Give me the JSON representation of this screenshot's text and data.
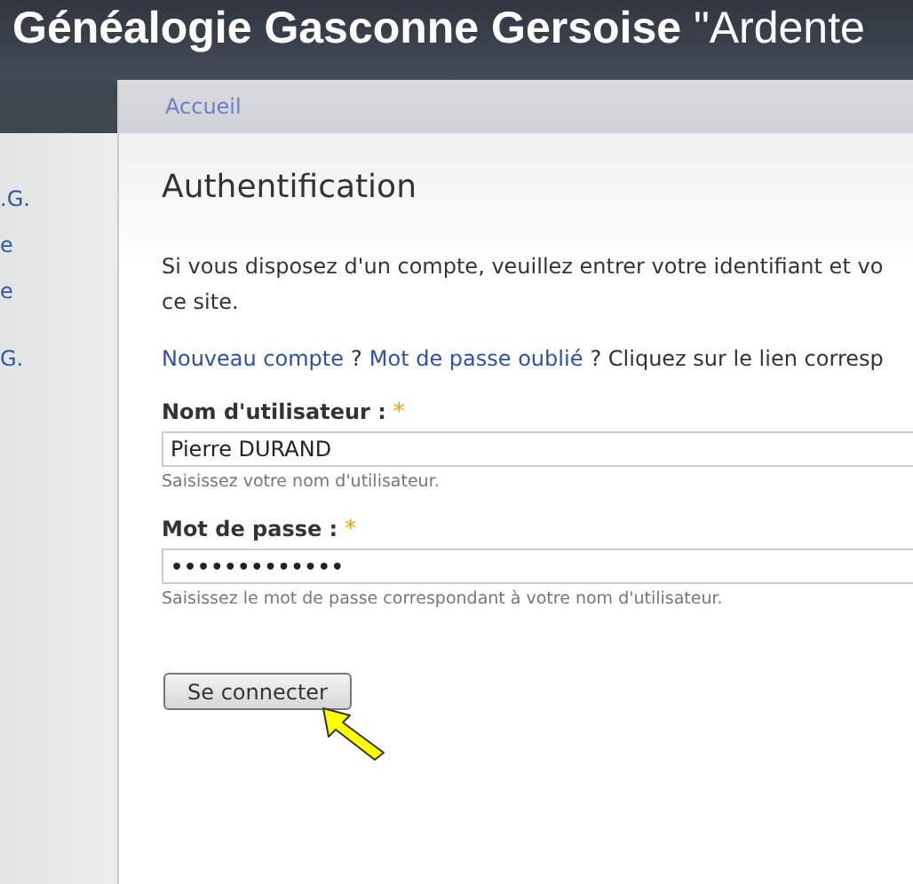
{
  "site_title": "**Généalogie Gasconne Gersoise** \"Ardente",
  "sidebar": {
    "items": [
      ".G.",
      "e",
      "e",
      "G."
    ]
  },
  "breadcrumb": "Accueil",
  "heading": "Authentification",
  "intro_lines": [
    "Si vous disposez d'un compte, veuillez entrer votre identifiant et vo",
    "ce site."
  ],
  "help_line": [
    {
      "kind": "link",
      "text": "Nouveau compte"
    },
    {
      "kind": "text",
      "text": "?"
    },
    {
      "kind": "link",
      "text": "Mot de passe oublié"
    },
    {
      "kind": "text",
      "text": "? Cliquez sur le lien corresp"
    }
  ],
  "fields": [
    {
      "label": "Nom d'utilisateur :",
      "required_mark": "*",
      "value": "Pierre DURAND",
      "masked": false,
      "hint": "Saisissez votre nom d'utilisateur."
    },
    {
      "label": "Mot de passe :",
      "required_mark": "*",
      "value": "•••••••••••••",
      "masked": true,
      "hint": "Saisissez le mot de passe correspondant à votre nom d'utilisateur."
    }
  ],
  "submit": "Se connecter"
}
